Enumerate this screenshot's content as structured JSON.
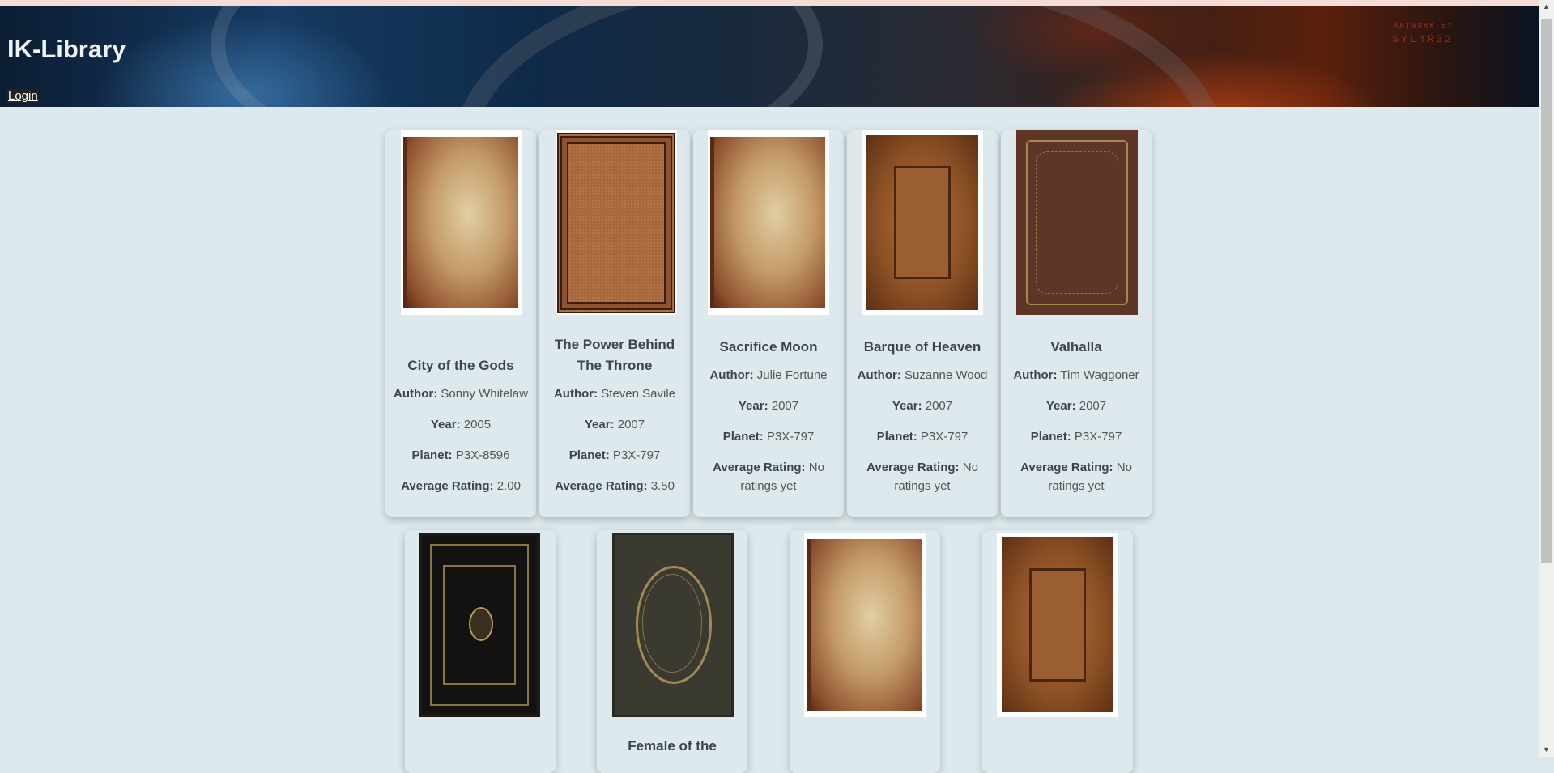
{
  "header": {
    "title": "IK-Library",
    "login_label": "Login",
    "artwork_credit_1": "ARTWORK BY",
    "artwork_credit_2": "SYL4R32"
  },
  "labels": {
    "author": "Author:",
    "year": "Year:",
    "planet": "Planet:",
    "rating": "Average Rating:"
  },
  "books": [
    {
      "title": "City of the Gods",
      "author": "Sonny Whitelaw",
      "year": "2005",
      "planet": "P3X-8596",
      "rating": "2.00",
      "cover": "plain-tan-cover"
    },
    {
      "title": "The Power Behind The Throne",
      "author": "Steven Savile",
      "year": "2007",
      "planet": "P3X-797",
      "rating": "3.50",
      "cover": "ornate-brown-cover"
    },
    {
      "title": "Sacrifice Moon",
      "author": "Julie Fortune",
      "year": "2007",
      "planet": "P3X-797",
      "rating": "No ratings yet",
      "cover": "plain-tan-cover"
    },
    {
      "title": "Barque of Heaven",
      "author": "Suzanne Wood",
      "year": "2007",
      "planet": "P3X-797",
      "rating": "No ratings yet",
      "cover": "panel-brown-cover"
    },
    {
      "title": "Valhalla",
      "author": "Tim Waggoner",
      "year": "2007",
      "planet": "P3X-797",
      "rating": "No ratings yet",
      "cover": "filigree-maroon-cover"
    },
    {
      "title": "",
      "cover": "black-gold-cover"
    },
    {
      "title": "Female of the",
      "cover": "dark-green-oval-cover"
    },
    {
      "title": "",
      "cover": "plain-tan-cover"
    },
    {
      "title": "",
      "cover": "panel-brown-cover"
    }
  ]
}
